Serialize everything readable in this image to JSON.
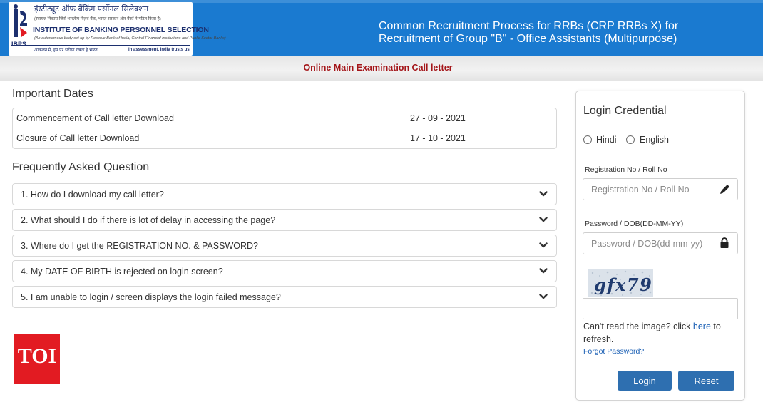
{
  "header": {
    "logo": {
      "hindi_name": "इंस्टीट्यूट ऑफ बैंकिंग पर्सोनल सिलेक्शन",
      "hindi_tagline": "(स्वायत्त निकाय जिसे भारतीय रिज़र्व बैंक, भारत सरकार और बैंकों ने गठित किया है)",
      "english_name": "INSTITUTE OF BANKING PERSONNEL SELECTION",
      "english_tagline": "(An autonomous body set up by Reserve Bank of India, Central Financial Institutions and Public Sector Banks)",
      "abbr": "IBPS",
      "motto_hindi": "आंकलन में, हम पर भरोसा रखता है भारत",
      "motto_english": "In assessment, India trusts us"
    },
    "title_line1": "Common Recruitment Process for RRBs (CRP RRBs X) for",
    "title_line2": "Recruitment of Group \"B\" - Office Assistants (Multipurpose)",
    "brand_color": "#1a7ad0"
  },
  "subheader": {
    "text": "Online Main Examination Call letter",
    "color": "#a4161a"
  },
  "important_dates": {
    "heading": "Important Dates",
    "rows": [
      {
        "label": "Commencement of Call letter Download",
        "value": "27 - 09 - 2021"
      },
      {
        "label": "Closure of Call letter Download",
        "value": "17 - 10 - 2021"
      }
    ]
  },
  "faq": {
    "heading": "Frequently Asked Question",
    "items": [
      "1. How do I download my call letter?",
      "2. What should I do if there is lot of delay in accessing the page?",
      "3. Where do I get the REGISTRATION NO. & PASSWORD?",
      "4. My DATE OF BIRTH is rejected on login screen?",
      "5. I am unable to login / screen displays the login failed message?"
    ],
    "icon": "chevron-down-icon"
  },
  "watermark": {
    "text": "TOI",
    "color": "#e21b22"
  },
  "login": {
    "title": "Login Credential",
    "languages": [
      "Hindi",
      "English"
    ],
    "reg_label": "Registration No / Roll No",
    "reg_placeholder": "Registration No / Roll No",
    "reg_icon": "pencil-icon",
    "pwd_label": "Password / DOB(DD-MM-YY)",
    "pwd_placeholder": "Password / DOB(dd-mm-yy)",
    "pwd_icon": "lock-icon",
    "captcha_text": "gfx79",
    "captcha_input_value": "",
    "cant_read_prefix": "Can't read the image? click",
    "cant_read_link": "here",
    "cant_read_suffix": "to refresh.",
    "forgot_password": "Forgot Password?",
    "login_button": "Login",
    "reset_button": "Reset",
    "button_color": "#2e6fb0"
  }
}
